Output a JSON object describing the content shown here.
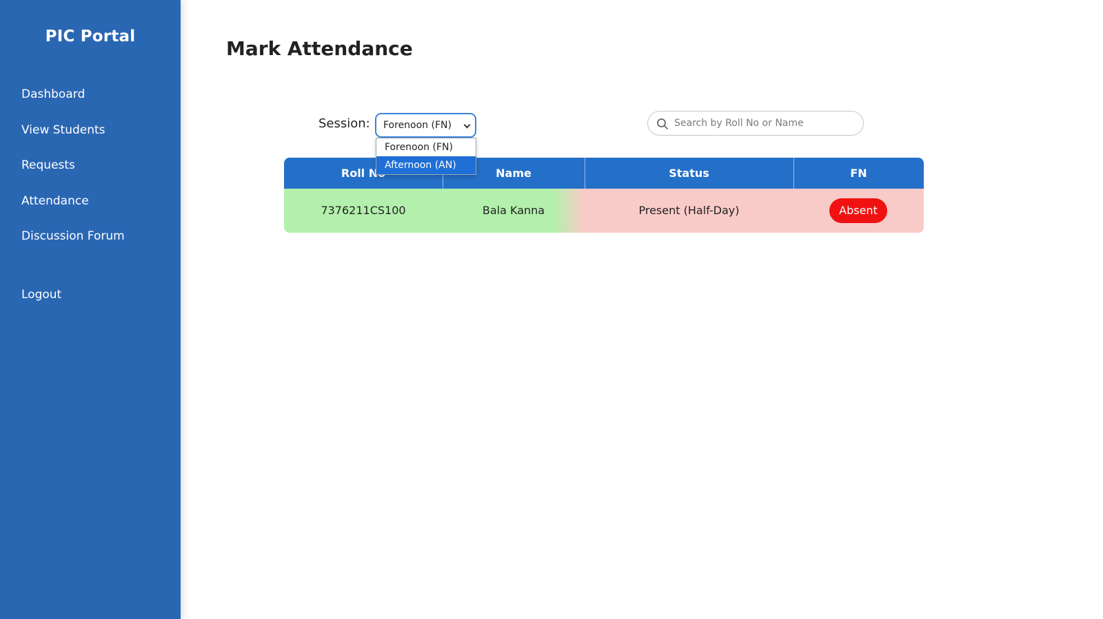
{
  "sidebar": {
    "brand": "PIC Portal",
    "items": [
      {
        "label": "Dashboard"
      },
      {
        "label": "View Students"
      },
      {
        "label": "Requests"
      },
      {
        "label": "Attendance"
      },
      {
        "label": "Discussion Forum"
      }
    ],
    "logout_label": "Logout",
    "color": "#2a67b3"
  },
  "main": {
    "title": "Mark Attendance",
    "session": {
      "label": "Session:",
      "selected": "Forenoon (FN)",
      "options": [
        "Forenoon (FN)",
        "Afternoon (AN)"
      ],
      "highlighted_option": "Afternoon (AN)"
    },
    "search": {
      "placeholder": "Search by Roll No or Name",
      "icon": "search-icon"
    },
    "table": {
      "columns": [
        "Roll No",
        "Name",
        "Status",
        "FN"
      ],
      "rows": [
        {
          "roll_no": "7376211CS100",
          "name": "Bala Kanna",
          "status": "Present (Half-Day)",
          "action": "Absent"
        }
      ],
      "header_color": "#2470c8",
      "present_color": "#b3f0ad",
      "absent_row_color": "#f9cbc8",
      "absent_button_color": "#f01212"
    }
  }
}
